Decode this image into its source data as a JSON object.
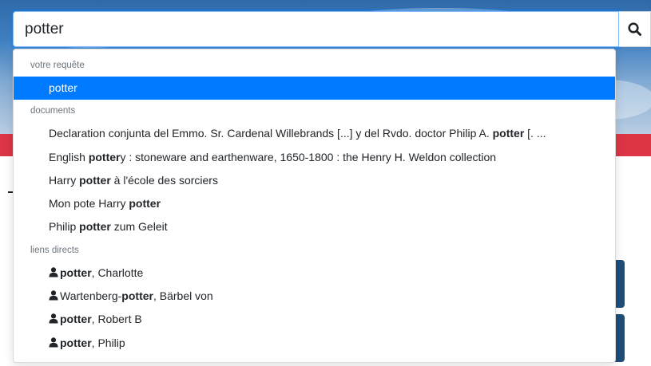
{
  "search": {
    "value": "potter"
  },
  "dropdown": {
    "query_header": "votre requête",
    "query_item": "potter",
    "documents_header": "documents",
    "documents": [
      {
        "before": "Declaration conjunta del Emmo. Sr. Cardenal Willebrands [...] y del Rvdo. doctor Philip A. ",
        "match": "potter",
        "after": " [. ..."
      },
      {
        "before": "English ",
        "match": "potter",
        "after": "y : stoneware and earthenware, 1650-1800 : the Henry H. Weldon collection"
      },
      {
        "before": "Harry ",
        "match": "potter",
        "after": " à l'école des sorciers"
      },
      {
        "before": "Mon pote Harry ",
        "match": "potter",
        "after": ""
      },
      {
        "before": "Philip ",
        "match": "potter",
        "after": " zum Geleit"
      }
    ],
    "links_header": "liens directs",
    "links": [
      {
        "icon": "user-icon",
        "before": "",
        "match": "potter",
        "after": ", Charlotte"
      },
      {
        "icon": "user-icon",
        "before": "Wartenberg-",
        "match": "potter",
        "after": ", Bärbel von"
      },
      {
        "icon": "user-icon",
        "before": "",
        "match": "potter",
        "after": ", Robert B"
      },
      {
        "icon": "user-icon",
        "before": "",
        "match": "potter",
        "after": ", Philip"
      }
    ]
  },
  "colors": {
    "active": "#007bff",
    "banner_red": "#dc3545",
    "card": "#1f4e79"
  }
}
